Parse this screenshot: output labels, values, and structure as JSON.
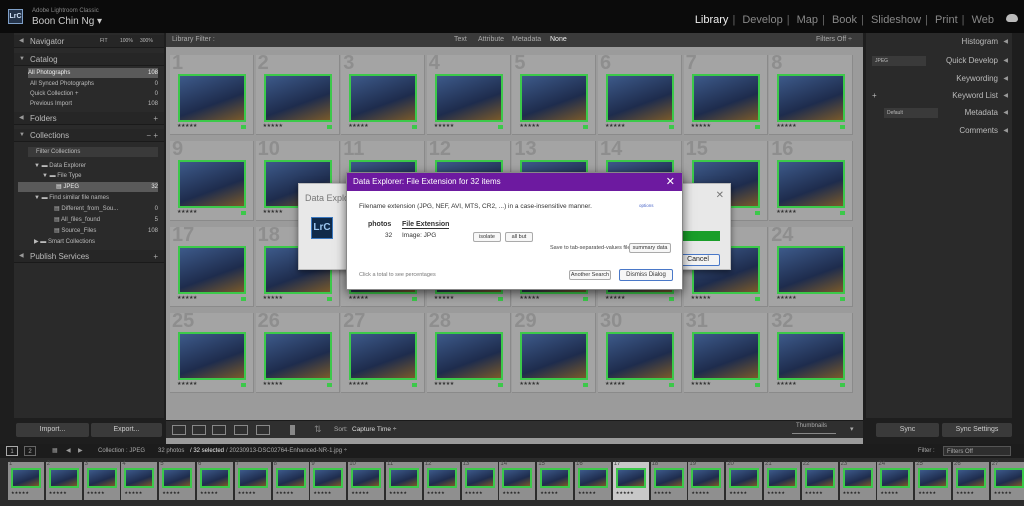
{
  "app": {
    "brand": "Adobe Lightroom Classic",
    "user": "Boon Chin Ng",
    "logo": "LrC"
  },
  "modules": [
    "Library",
    "Develop",
    "Map",
    "Book",
    "Slideshow",
    "Print",
    "Web"
  ],
  "active_module": "Library",
  "colors": {
    "accent_green": "#3cc94a",
    "dialog_purple": "#6d1aa0",
    "lrc_blue": "#3a78c0"
  },
  "left": {
    "navigator": {
      "title": "Navigator",
      "zoom": [
        "FIT",
        "100%",
        "300%"
      ]
    },
    "catalog": {
      "title": "Catalog",
      "items": [
        {
          "label": "All Photographs",
          "count": "108"
        },
        {
          "label": "All Synced Photographs",
          "count": "0"
        },
        {
          "label": "Quick Collection +",
          "count": "0"
        },
        {
          "label": "Previous Import",
          "count": "108"
        }
      ]
    },
    "folders": {
      "title": "Folders"
    },
    "collections": {
      "title": "Collections",
      "filter": "Filter Collections",
      "items": [
        {
          "label": "Data Explorer",
          "count": ""
        },
        {
          "label": "File Type",
          "count": ""
        },
        {
          "label": "JPEG",
          "count": "32"
        },
        {
          "label": "Find similar file names",
          "count": ""
        },
        {
          "label": "Different_from_Sou...",
          "count": "0"
        },
        {
          "label": "All_files_found",
          "count": "5"
        },
        {
          "label": "Source_Files",
          "count": "108"
        },
        {
          "label": "Smart Collections",
          "count": ""
        }
      ]
    },
    "publish": {
      "title": "Publish Services"
    },
    "import_label": "Import...",
    "export_label": "Export..."
  },
  "right": {
    "panels": [
      "Histogram",
      "Quick Develop",
      "Keywording",
      "Keyword List",
      "Metadata",
      "Comments"
    ],
    "quick_develop_preset": "JPEG",
    "metadata_preset": "Default",
    "sync_label": "Sync",
    "sync_settings_label": "Sync Settings"
  },
  "library_filter": {
    "title": "Library Filter :",
    "options": [
      "Text",
      "Attribute",
      "Metadata",
      "None"
    ],
    "active": "None",
    "filters_off": "Filters Off ÷"
  },
  "grid": {
    "numbers": [
      "1",
      "2",
      "3",
      "4",
      "5",
      "6",
      "7",
      "8",
      "9",
      "10",
      "11",
      "12",
      "13",
      "14",
      "15",
      "16",
      "17",
      "18",
      "19",
      "20",
      "21",
      "22",
      "23",
      "24",
      "25",
      "26",
      "27",
      "28",
      "29",
      "30",
      "31",
      "32"
    ],
    "stars": "★★★★★"
  },
  "back_dialog": {
    "title": "Data Explorer",
    "icon": "LrC",
    "cancel_label": "Cancel"
  },
  "dialog": {
    "title": "Data Explorer: File Extension for 32 items",
    "description": "Filename extension (JPG, NEF, AVI, MTS, CR2, ...) in a case-insensitive manner.",
    "options_label": "options",
    "col_photos": "photos",
    "col_ext": "File Extension",
    "count": "32",
    "ext_value": "Image:  JPG",
    "isolate_label": "isolate",
    "allbut_label": "all but",
    "save_label": "Save to tab-separated-values file:",
    "summary_label": "summary data",
    "hint": "Click a total to see percentages",
    "another_label": "Another Search",
    "dismiss_label": "Dismiss Dialog"
  },
  "toolbar": {
    "sort_label": "Sort:",
    "sort_value": "Capture Time ÷",
    "thumbs_label": "Thumbnails"
  },
  "filmstrip_bar": {
    "pages": [
      "1",
      "2"
    ],
    "path": "Collection : JPEG",
    "count": "32 photos",
    "selected": "/ 32 selected",
    "file": "/ 20230913-DSC02764-Enhanced-NR-1.jpg ÷",
    "filter_label": "Filter :",
    "filter_value": "Filters Off"
  }
}
